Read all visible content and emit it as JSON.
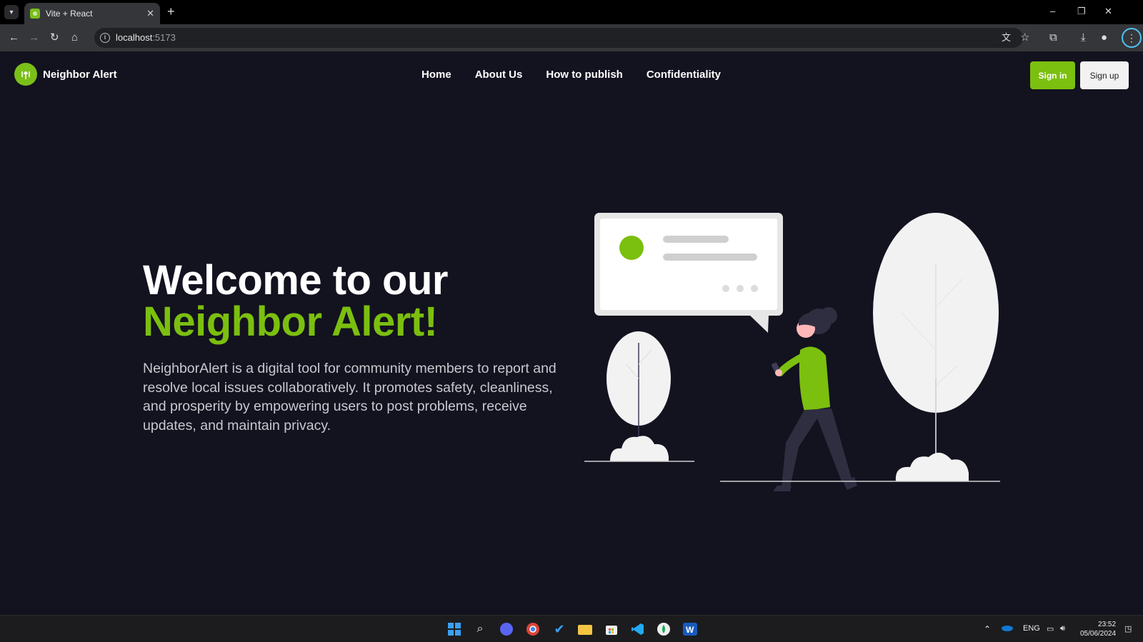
{
  "browser": {
    "tab_title": "Vite + React",
    "tab_close": "✕",
    "new_tab": "+",
    "url_host": "localhost",
    "url_port": ":5173",
    "window_controls": [
      "–",
      "❐",
      "✕"
    ]
  },
  "header": {
    "brand": "Neighbor Alert",
    "nav": [
      "Home",
      "About Us",
      "How to publish",
      "Confidentiality"
    ],
    "sign_in": "Sign in",
    "sign_up": "Sign up"
  },
  "hero": {
    "title_line1": "Welcome to our",
    "title_line2": "Neighbor Alert!",
    "description": "NeighborAlert is a digital tool for community members to report and resolve local issues collaboratively. It promotes safety, cleanliness, and prosperity by empowering users to post problems, receive updates, and maintain privacy."
  },
  "taskbar": {
    "language": "ENG",
    "time": "23:52",
    "date": "05/06/2024"
  },
  "colors": {
    "accent": "#7bbf0f",
    "background": "#13121f",
    "illustration_light": "#f2f2f2"
  },
  "icons": [
    "tab-list-icon",
    "back-icon",
    "forward-icon",
    "reload-icon",
    "home-icon",
    "site-info-icon",
    "translate-icon",
    "bookmark-star-icon",
    "extensions-icon",
    "download-icon",
    "profile-icon",
    "menu-icon",
    "windows-start-icon",
    "search-icon",
    "discord-icon",
    "chrome-icon",
    "todo-icon",
    "file-explorer-icon",
    "store-icon",
    "vscode-icon",
    "mongodb-icon",
    "word-icon",
    "chevron-up-icon",
    "onedrive-icon",
    "network-icon",
    "volume-icon",
    "notification-icon"
  ]
}
